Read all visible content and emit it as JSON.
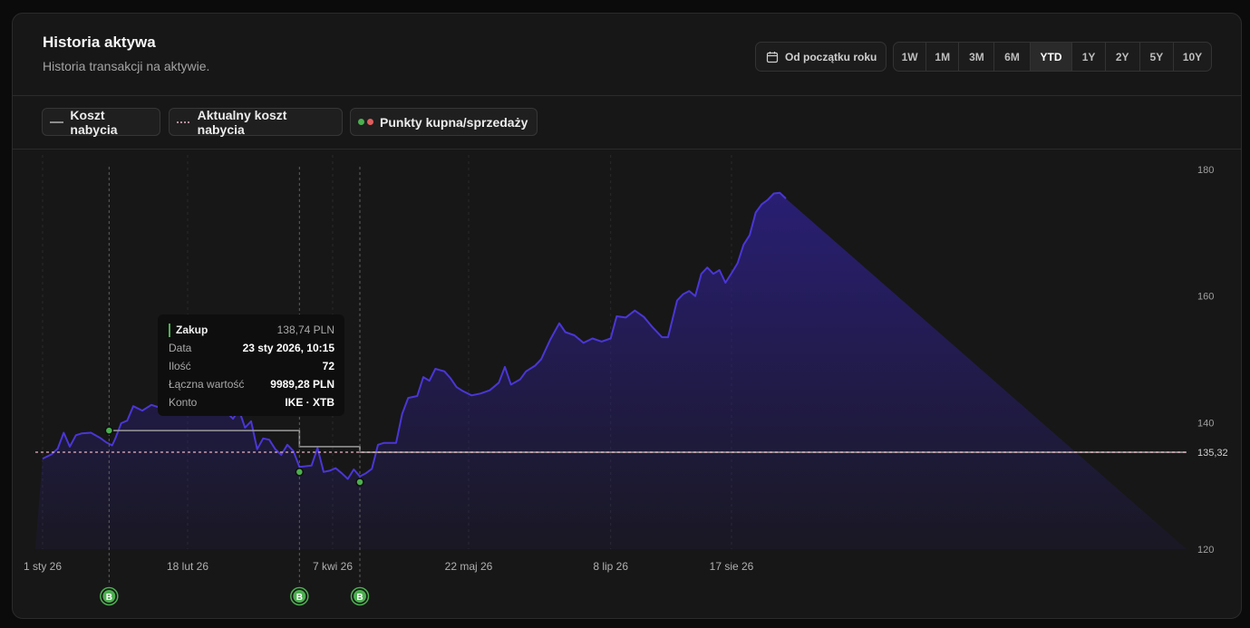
{
  "header": {
    "title": "Historia aktywa",
    "subtitle": "Historia transakcji na aktywie.",
    "range_button": "Od początku roku",
    "calendar_icon": "calendar-icon",
    "tabs": [
      {
        "label": "1W",
        "active": false
      },
      {
        "label": "1M",
        "active": false
      },
      {
        "label": "3M",
        "active": false
      },
      {
        "label": "6M",
        "active": false
      },
      {
        "label": "YTD",
        "active": true
      },
      {
        "label": "1Y",
        "active": false
      },
      {
        "label": "2Y",
        "active": false
      },
      {
        "label": "5Y",
        "active": false
      },
      {
        "label": "10Y",
        "active": false
      }
    ]
  },
  "legend": {
    "cost": "Koszt nabycia",
    "current_cost": "Aktualny koszt nabycia",
    "points": "Punkty kupna/sprzedaży"
  },
  "colors": {
    "line": "#4a36d6",
    "area": "#2a1f78",
    "cost": "#9a9a9a",
    "current_cost": "#e8b4c2",
    "buy": "#4caf50",
    "sell": "#e05d5d"
  },
  "tooltip": {
    "type": "Zakup",
    "price": "138,74 PLN",
    "rows": [
      {
        "label": "Data",
        "value": "23 sty 2026, 10:15"
      },
      {
        "label": "Ilość",
        "value": "72"
      },
      {
        "label": "Łączna wartość",
        "value": "9989,28 PLN"
      },
      {
        "label": "Konto",
        "value": "IKE · XTB"
      }
    ]
  },
  "chart_data": {
    "type": "area",
    "x_range": [
      "2026-01-01",
      "2026-08-17"
    ],
    "ylim": [
      120,
      180
    ],
    "y_ticks": [
      120,
      140,
      160,
      180
    ],
    "x_ticks": [
      {
        "date": "2026-01-01",
        "label": "1 sty 26"
      },
      {
        "date": "2026-02-18",
        "label": "18 lut 26"
      },
      {
        "date": "2026-04-07",
        "label": "7 kwi 26"
      },
      {
        "date": "2026-05-22",
        "label": "22 maj 26"
      },
      {
        "date": "2026-07-08",
        "label": "8 lip 26"
      },
      {
        "date": "2026-08-17",
        "label": "17 sie 26"
      }
    ],
    "current_cost_label": "135,32",
    "current_cost_value": 135.32,
    "series": [
      {
        "values": [
          [
            "2026-01-01",
            134.3
          ],
          [
            "2026-01-04",
            135.0
          ],
          [
            "2026-01-06",
            135.9
          ],
          [
            "2026-01-08",
            138.4
          ],
          [
            "2026-01-10",
            136.2
          ],
          [
            "2026-01-12",
            138.0
          ],
          [
            "2026-01-14",
            138.3
          ],
          [
            "2026-01-17",
            138.4
          ],
          [
            "2026-01-20",
            137.6
          ],
          [
            "2026-01-22",
            136.9
          ],
          [
            "2026-01-24",
            136.4
          ],
          [
            "2026-01-25",
            137.4
          ],
          [
            "2026-01-27",
            139.9
          ],
          [
            "2026-01-29",
            140.3
          ],
          [
            "2026-01-31",
            142.6
          ],
          [
            "2026-02-03",
            141.9
          ],
          [
            "2026-02-06",
            142.8
          ],
          [
            "2026-02-10",
            142.2
          ],
          [
            "2026-02-14",
            142.9
          ],
          [
            "2026-02-18",
            142.4
          ],
          [
            "2026-02-22",
            141.8
          ],
          [
            "2026-02-26",
            142.7
          ],
          [
            "2026-03-02",
            142.1
          ],
          [
            "2026-03-05",
            140.6
          ],
          [
            "2026-03-07",
            142.0
          ],
          [
            "2026-03-09",
            139.2
          ],
          [
            "2026-03-11",
            140.2
          ],
          [
            "2026-03-13",
            135.8
          ],
          [
            "2026-03-15",
            137.5
          ],
          [
            "2026-03-17",
            137.3
          ],
          [
            "2026-03-19",
            135.8
          ],
          [
            "2026-03-21",
            134.9
          ],
          [
            "2026-03-23",
            136.5
          ],
          [
            "2026-03-25",
            135.5
          ],
          [
            "2026-03-27",
            133.0
          ],
          [
            "2026-03-29",
            133.1
          ],
          [
            "2026-03-31",
            133.2
          ],
          [
            "2026-04-02",
            136.0
          ],
          [
            "2026-04-04",
            132.2
          ],
          [
            "2026-04-06",
            132.4
          ],
          [
            "2026-04-08",
            132.8
          ],
          [
            "2026-04-10",
            132.0
          ],
          [
            "2026-04-12",
            131.1
          ],
          [
            "2026-04-14",
            132.6
          ],
          [
            "2026-04-16",
            131.5
          ],
          [
            "2026-04-18",
            132.0
          ],
          [
            "2026-04-20",
            132.7
          ],
          [
            "2026-04-22",
            136.5
          ],
          [
            "2026-04-24",
            136.8
          ],
          [
            "2026-04-28",
            136.8
          ],
          [
            "2026-04-30",
            141.4
          ],
          [
            "2026-05-02",
            143.9
          ],
          [
            "2026-05-05",
            144.2
          ],
          [
            "2026-05-07",
            147.2
          ],
          [
            "2026-05-09",
            146.6
          ],
          [
            "2026-05-11",
            148.5
          ],
          [
            "2026-05-14",
            148.1
          ],
          [
            "2026-05-16",
            147.0
          ],
          [
            "2026-05-18",
            145.6
          ],
          [
            "2026-05-20",
            145.0
          ],
          [
            "2026-05-23",
            144.3
          ],
          [
            "2026-05-26",
            144.6
          ],
          [
            "2026-05-29",
            145.1
          ],
          [
            "2026-06-01",
            146.3
          ],
          [
            "2026-06-03",
            148.8
          ],
          [
            "2026-06-05",
            146.0
          ],
          [
            "2026-06-08",
            146.8
          ],
          [
            "2026-06-10",
            148.1
          ],
          [
            "2026-06-13",
            149.0
          ],
          [
            "2026-06-15",
            150.0
          ],
          [
            "2026-06-18",
            153.1
          ],
          [
            "2026-06-21",
            155.7
          ],
          [
            "2026-06-23",
            154.3
          ],
          [
            "2026-06-26",
            153.8
          ],
          [
            "2026-06-29",
            152.6
          ],
          [
            "2026-07-02",
            153.3
          ],
          [
            "2026-07-05",
            152.8
          ],
          [
            "2026-07-08",
            153.3
          ],
          [
            "2026-07-10",
            156.8
          ],
          [
            "2026-07-13",
            156.6
          ],
          [
            "2026-07-16",
            157.7
          ],
          [
            "2026-07-19",
            156.7
          ],
          [
            "2026-07-22",
            155.0
          ],
          [
            "2026-07-25",
            153.5
          ],
          [
            "2026-07-27",
            153.5
          ],
          [
            "2026-07-30",
            159.3
          ],
          [
            "2026-08-01",
            160.3
          ],
          [
            "2026-08-03",
            160.8
          ],
          [
            "2026-08-05",
            160.0
          ],
          [
            "2026-08-07",
            163.5
          ],
          [
            "2026-08-09",
            164.5
          ],
          [
            "2026-08-11",
            163.5
          ],
          [
            "2026-08-13",
            164.1
          ],
          [
            "2026-08-15",
            162.1
          ],
          [
            "2026-08-17",
            163.6
          ],
          [
            "2026-08-19",
            165.2
          ],
          [
            "2026-08-21",
            168.1
          ],
          [
            "2026-08-23",
            169.6
          ],
          [
            "2026-08-25",
            173.2
          ],
          [
            "2026-08-27",
            174.5
          ],
          [
            "2026-08-29",
            175.2
          ],
          [
            "2026-08-31",
            176.2
          ],
          [
            "2026-09-02",
            176.3
          ],
          [
            "2026-09-04",
            175.4
          ]
        ]
      }
    ],
    "cost_steps": [
      {
        "from": "2026-01-23",
        "value": 138.74
      },
      {
        "from": "2026-03-27",
        "value": 136.2
      },
      {
        "from": "2026-04-16",
        "value": 135.32
      }
    ],
    "transactions": [
      {
        "date": "2026-01-23",
        "price": 138.74,
        "side": "B"
      },
      {
        "date": "2026-03-27",
        "price": 132.2,
        "side": "B"
      },
      {
        "date": "2026-04-16",
        "price": 130.6,
        "side": "B"
      }
    ]
  }
}
